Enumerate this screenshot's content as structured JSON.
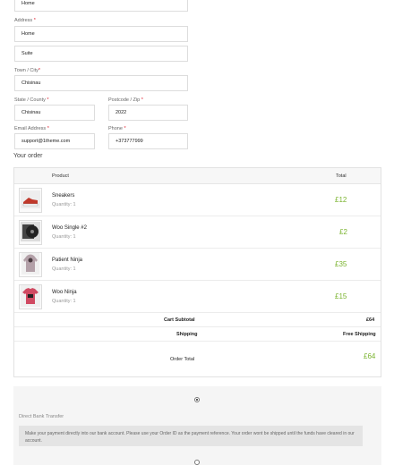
{
  "billing": {
    "address_line1_value": "Home",
    "address_label": "Address",
    "address_value": "Home",
    "address2_value": "Suite",
    "city_label": "Town / City",
    "city_value": "Chisinau",
    "state_label": "State / County",
    "state_value": "Chisinau",
    "postcode_label": "Postcode / Zip",
    "postcode_value": "2022",
    "email_label": "Email Address",
    "email_value": "support@1theme.com",
    "phone_label": "Phone",
    "phone_value": "+373777999",
    "required_mark": "*"
  },
  "order": {
    "title": "Your order",
    "col_product": "Product",
    "col_total": "Total",
    "items": [
      {
        "name": "Sneakers",
        "qty": "Quantity: 1",
        "price": "£12",
        "thumb_color": "#c0392b",
        "icon": "sneakers-icon"
      },
      {
        "name": "Woo Single #2",
        "qty": "Quantity: 1",
        "price": "£2",
        "thumb_color": "#333333",
        "icon": "vinyl-record-icon"
      },
      {
        "name": "Patient Ninja",
        "qty": "Quantity: 1",
        "price": "£35",
        "thumb_color": "#b3a0a8",
        "icon": "hoodie-icon"
      },
      {
        "name": "Woo Ninja",
        "qty": "Quantity: 1",
        "price": "£15",
        "thumb_color": "#d04a62",
        "icon": "tshirt-icon"
      }
    ],
    "subtotal_label": "Cart Subtotal",
    "subtotal_value": "£64",
    "shipping_label": "Shipping",
    "shipping_value": "Free Shipping",
    "total_label": "Order Total",
    "total_value": "£64"
  },
  "payment": {
    "method_label": "Direct Bank Transfer",
    "description": "Make your payment directly into our bank account. Please use your Order ID as the payment reference. Your order wont be shipped until the funds have cleared in our account."
  },
  "colors": {
    "accent_green": "#7ab32e",
    "required_red": "#e0202f"
  }
}
